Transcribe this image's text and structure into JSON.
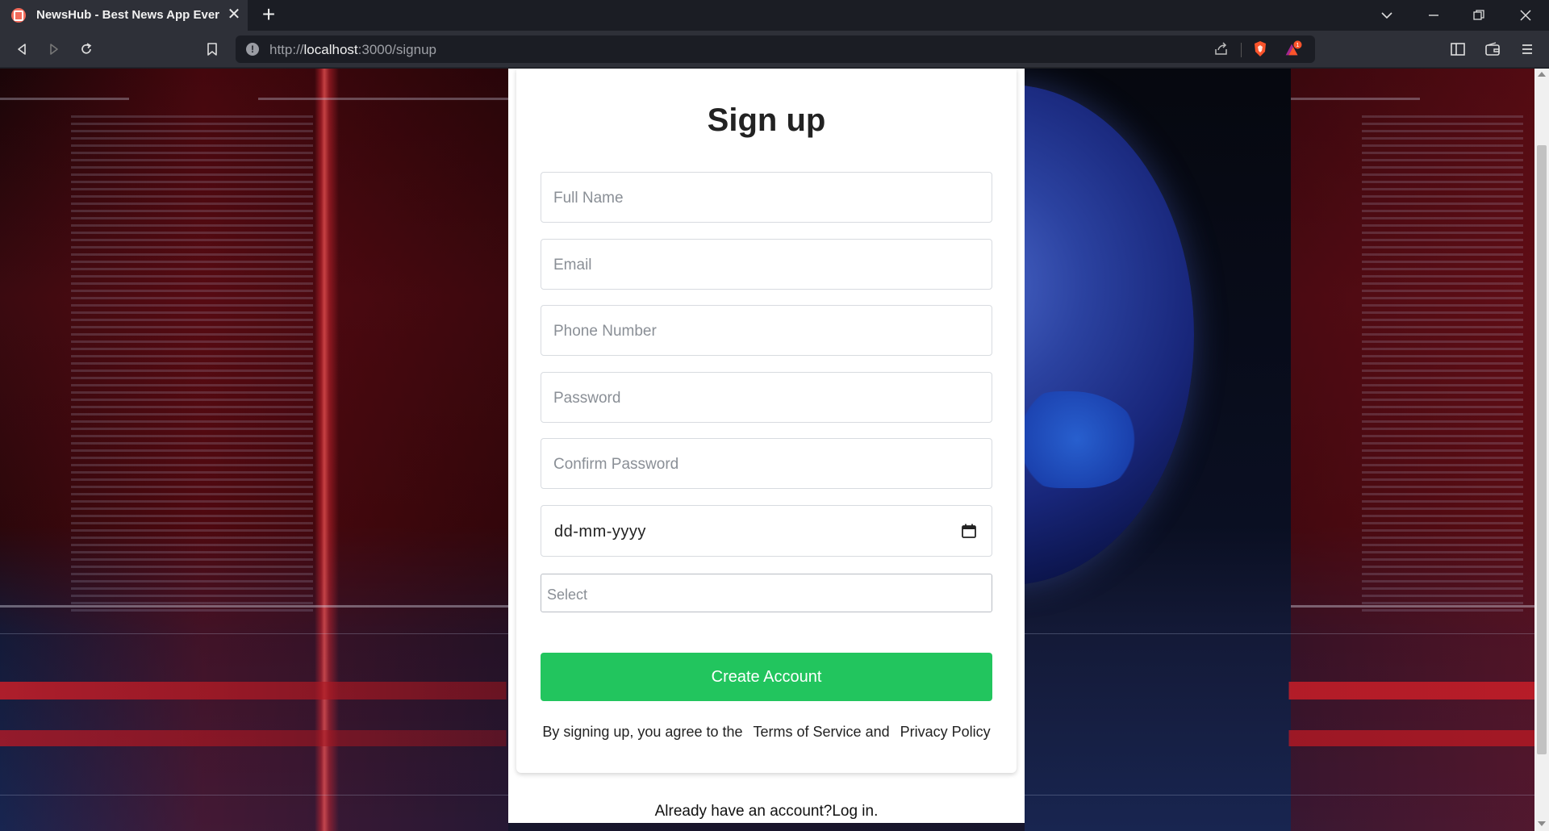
{
  "browser": {
    "tab": {
      "title": "NewsHub - Best News App Ever",
      "favicon": "newshub-favicon-icon",
      "close_symbol": "✕"
    },
    "new_tab_symbol": "+",
    "url": {
      "scheme": "http://",
      "host": "localhost",
      "rest": ":3000/signup",
      "info_symbol": "!"
    },
    "icons": {
      "back": "back-icon",
      "forward": "forward-icon",
      "reload": "reload-icon",
      "bookmark": "bookmark-icon",
      "share": "share-icon",
      "brave_shields": "brave-shields-icon",
      "brave_rewards": "brave-rewards-icon",
      "sidebar": "sidebar-icon",
      "wallet": "wallet-icon",
      "menu": "menu-icon"
    },
    "rewards_badge": "1",
    "colors": {
      "chrome_dark": "#1b1d24",
      "chrome_tab": "#2e3038",
      "brave_orange": "#fb542b"
    }
  },
  "signup": {
    "title": "Sign up",
    "fields": {
      "full_name_placeholder": "Full Name",
      "email_placeholder": "Email",
      "phone_placeholder": "Phone Number",
      "password_placeholder": "Password",
      "confirm_password_placeholder": "Confirm Password",
      "date_placeholder": "dd-mm-yyyy",
      "select_placeholder": "Select"
    },
    "create_button": "Create Account",
    "terms": {
      "prefix": "By signing up, you agree to the",
      "terms_link": "Terms of Service",
      "and": "and",
      "privacy_link": "Privacy Policy"
    },
    "login": {
      "prefix": "Already have an account?",
      "link": "Log in."
    },
    "colors": {
      "primary_button": "#22c55e",
      "card": "#ffffff",
      "placeholder": "#8a8f96"
    }
  }
}
